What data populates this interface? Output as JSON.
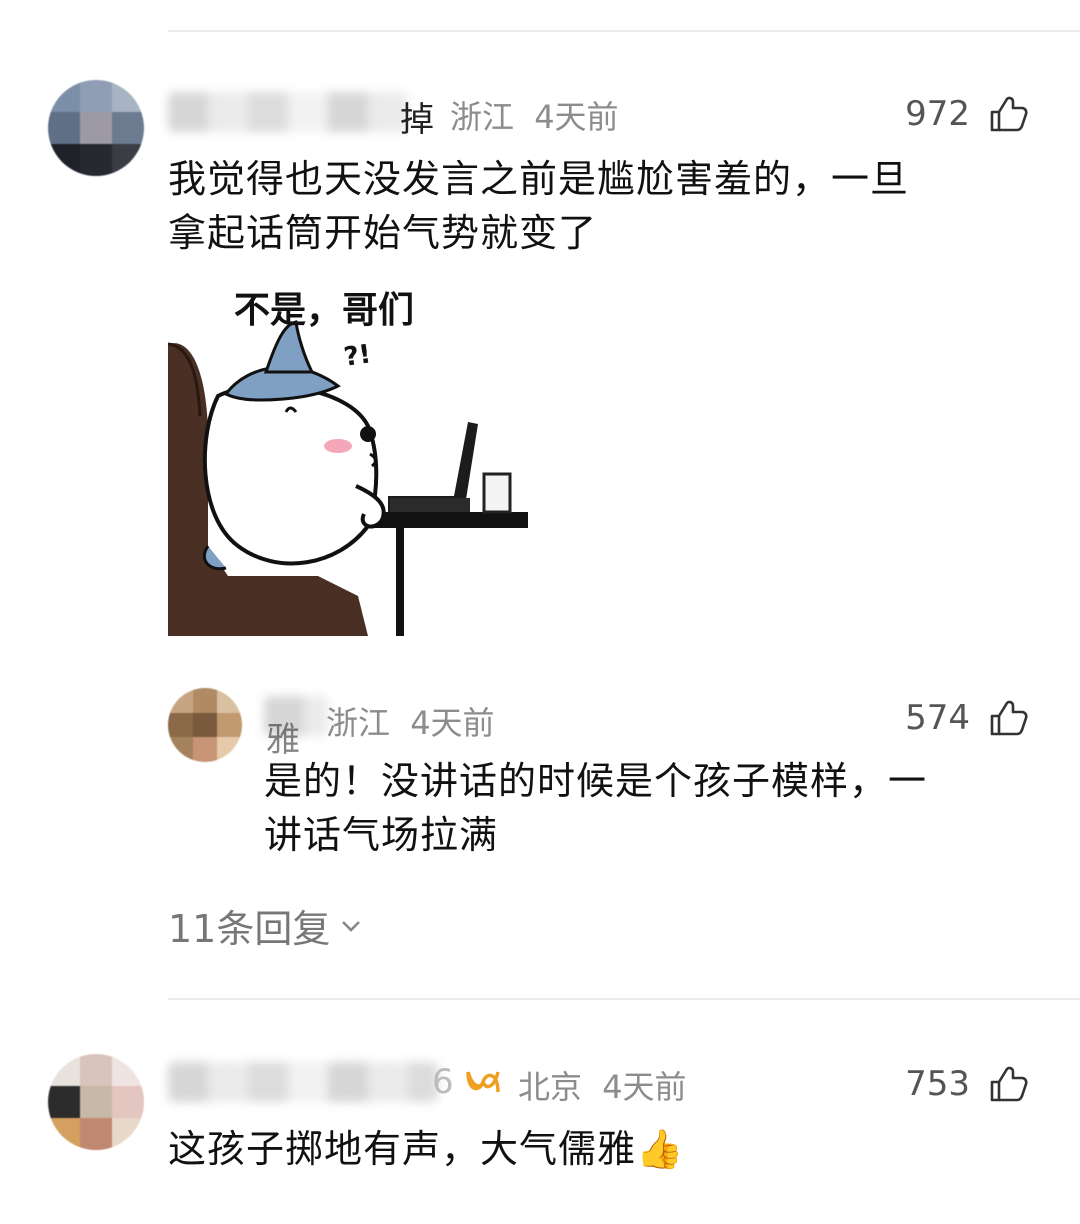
{
  "comments": [
    {
      "name_tail": "掉",
      "location": "浙江",
      "time": "4天前",
      "likes": "972",
      "text_lines": [
        "我觉得也天没发言之前是尴尬害羞的，一旦",
        "拿起话筒开始气势就变了"
      ],
      "sticker": {
        "caption": "不是，哥们",
        "marks": "?!"
      },
      "reply": {
        "name_tail": "雅",
        "location": "浙江",
        "time": "4天前",
        "likes": "574",
        "text_lines": [
          "是的！没讲话的时候是个孩子模样，一",
          "讲话气场拉满"
        ]
      },
      "replies_label": "11条回复"
    },
    {
      "name_tail": "6",
      "location": "北京",
      "time": "4天前",
      "likes": "753",
      "text": "这孩子掷地有声，大气儒雅👍"
    }
  ],
  "icons": {
    "like": "thumbs-up-icon",
    "expand": "chevron-down-icon",
    "badge": "infinity-badge-icon"
  },
  "colors": {
    "meta": "#8c8c8c",
    "badge": "#f0a020",
    "divider": "#ececec"
  }
}
